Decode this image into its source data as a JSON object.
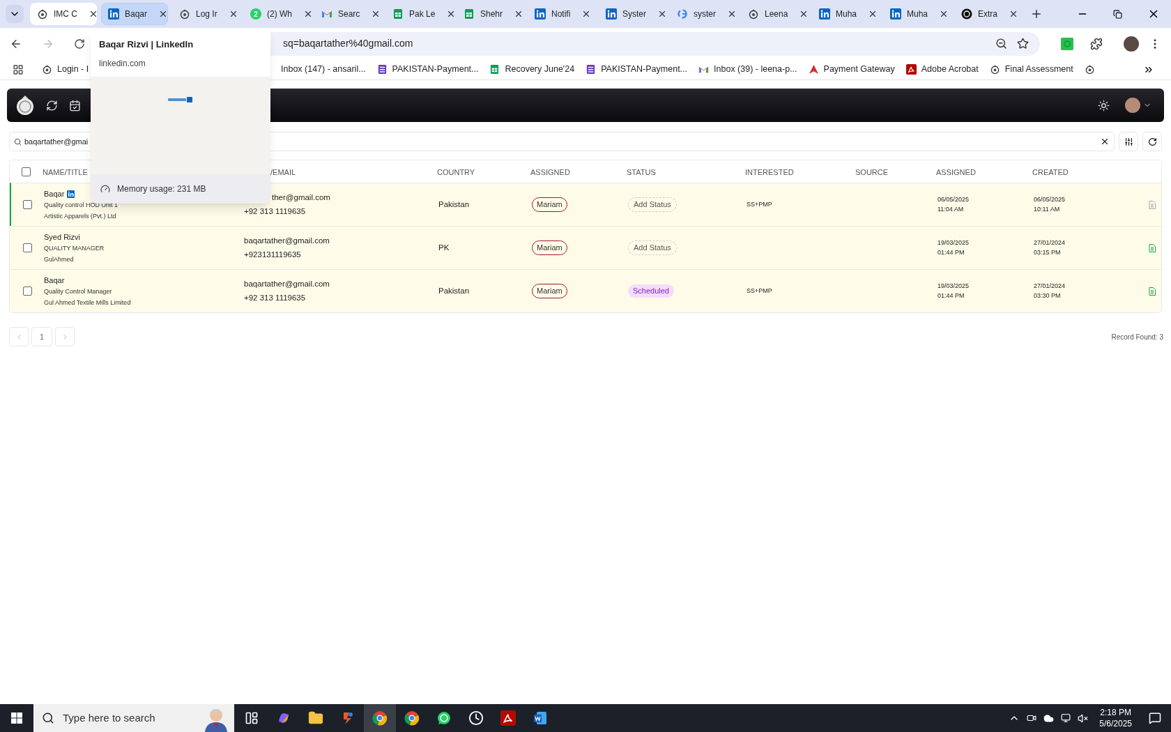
{
  "tabs": [
    {
      "title": "IMC C",
      "kind": "app",
      "selected": true,
      "highlighted": false
    },
    {
      "title": "Baqar",
      "kind": "linkedin",
      "selected": false,
      "highlighted": true
    },
    {
      "title": "Log Ir",
      "kind": "app",
      "selected": false,
      "highlighted": false
    },
    {
      "title": "(2) Wh",
      "kind": "whatsapp",
      "badge": "2",
      "selected": false,
      "highlighted": false
    },
    {
      "title": "Searc",
      "kind": "gmail",
      "selected": false,
      "highlighted": false
    },
    {
      "title": "Pak Le",
      "kind": "sheets",
      "selected": false,
      "highlighted": false
    },
    {
      "title": "Shehr",
      "kind": "sheets",
      "selected": false,
      "highlighted": false
    },
    {
      "title": "Notifi",
      "kind": "linkedin",
      "selected": false,
      "highlighted": false
    },
    {
      "title": "Syster",
      "kind": "linkedin",
      "selected": false,
      "highlighted": false
    },
    {
      "title": "syster",
      "kind": "google",
      "selected": false,
      "highlighted": false
    },
    {
      "title": "Leena",
      "kind": "app",
      "selected": false,
      "highlighted": false
    },
    {
      "title": "Muha",
      "kind": "linkedin",
      "selected": false,
      "highlighted": false
    },
    {
      "title": "Muha",
      "kind": "linkedin",
      "selected": false,
      "highlighted": false
    },
    {
      "title": "Extra",
      "kind": "openai",
      "selected": false,
      "highlighted": false
    }
  ],
  "address": "sq=baqartather%40gmail.com",
  "bookmarks": [
    {
      "label": "Login - I",
      "kind": "app"
    },
    {
      "label": "Inbox (147) - ansaril...",
      "kind": "none"
    },
    {
      "label": "PAKISTAN-Payment...",
      "kind": "forms"
    },
    {
      "label": "Recovery June'24",
      "kind": "sheets"
    },
    {
      "label": "PAKISTAN-Payment...",
      "kind": "forms"
    },
    {
      "label": "Inbox (39) - leena-p...",
      "kind": "gmail"
    },
    {
      "label": "Payment Gateway",
      "kind": "payment"
    },
    {
      "label": "Adobe Acrobat",
      "kind": "acrobat"
    },
    {
      "label": "Final Assessment",
      "kind": "app"
    },
    {
      "kind": "app"
    }
  ],
  "tab_preview": {
    "title": "Baqar Rizvi | LinkedIn",
    "domain": "linkedin.com",
    "memory": "Memory usage: 231 MB"
  },
  "search": {
    "value": "baqartather@gmai"
  },
  "table": {
    "select_all": {
      "checked": false
    },
    "columns": [
      "NAME/TITLE",
      "/EMAIL",
      "COUNTRY",
      "ASSIGNED",
      "STATUS",
      "INTERESTED",
      "SOURCE",
      "ASSIGNED",
      "CREATED"
    ],
    "rows": [
      {
        "selected": true,
        "checked": false,
        "name": "Baqar",
        "linkedin": true,
        "title": "Quality control HOD Unit 1",
        "company": "Artistic Apparels (Pvt.) Ltd",
        "email": "ther@gmail.com",
        "phone": "+92 313 1119635",
        "country": "Pakistan",
        "assignee": "Mariam",
        "status": {
          "label": "Add Status",
          "kind": "add"
        },
        "interested": "SS+PMP",
        "assigned_date": "06/05/2025",
        "assigned_time": "11:04 AM",
        "created_date": "06/05/2025",
        "created_time": "10:11 AM",
        "note": {
          "color": "#9ca3af"
        }
      },
      {
        "selected": false,
        "checked": false,
        "name": "Syed Rizvi",
        "linkedin": false,
        "title": "QUALITY MANAGER",
        "company": "GulAhmed",
        "email": "baqartather@gmail.com",
        "phone": "+923131119635",
        "country": "PK",
        "assignee": "Mariam",
        "status": {
          "label": "Add Status",
          "kind": "add"
        },
        "assigned_date": "19/03/2025",
        "assigned_time": "01:44 PM",
        "created_date": "27/01/2024",
        "created_time": "03:15 PM",
        "note": {
          "color": "#16a34a"
        }
      },
      {
        "selected": false,
        "checked": false,
        "name": "Baqar",
        "linkedin": false,
        "title": "Quality Control Manager",
        "company": "Gul Ahmed Textile Mills Limited",
        "email": "baqartather@gmail.com",
        "phone": "+92 313 1119635",
        "country": "Pakistan",
        "assignee": "Mariam",
        "status": {
          "label": "Scheduled",
          "kind": "scheduled"
        },
        "interested": "SS+PMP",
        "assigned_date": "19/03/2025",
        "assigned_time": "01:44 PM",
        "created_date": "27/01/2024",
        "created_time": "03:30 PM",
        "note": {
          "color": "#16a34a"
        }
      }
    ]
  },
  "pagination": {
    "pages": [
      {
        "label": "1",
        "selected": true
      }
    ]
  },
  "record_count": "Record Found: 3",
  "taskbar": {
    "search_placeholder": "Type here to search",
    "apps": [
      {
        "kind": "taskview",
        "active": false
      },
      {
        "kind": "copilot",
        "active": false
      },
      {
        "kind": "folder",
        "active": false
      },
      {
        "kind": "tool",
        "active": false
      },
      {
        "kind": "chrome",
        "active": true
      },
      {
        "kind": "chrome",
        "active": false
      },
      {
        "kind": "whatsapp",
        "active": false
      },
      {
        "kind": "clock",
        "active": false
      },
      {
        "kind": "acrobat",
        "active": false
      },
      {
        "kind": "word",
        "active": false
      }
    ],
    "time": "2:18 PM",
    "date": "5/6/2025"
  }
}
